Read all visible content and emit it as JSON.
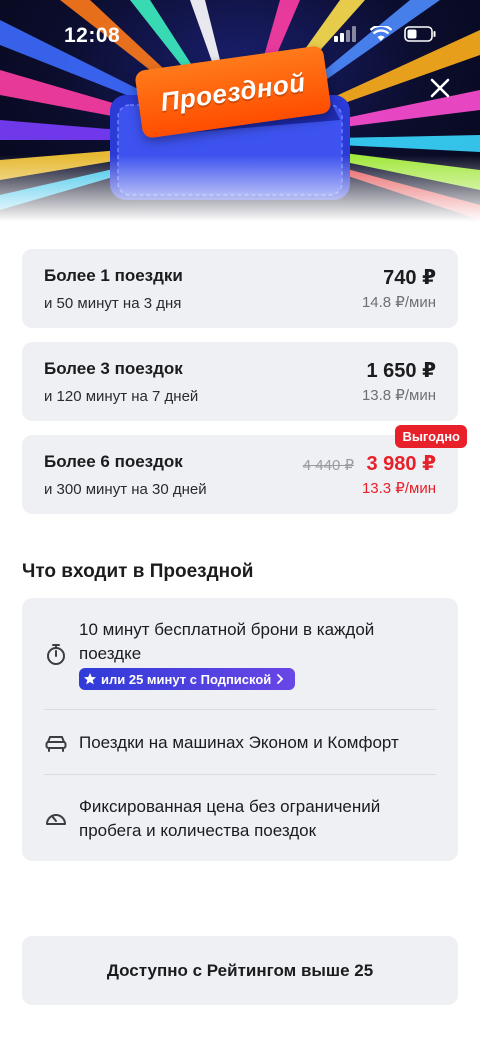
{
  "status_bar": {
    "time": "12:08"
  },
  "hero": {
    "ticket_label": "Проездной"
  },
  "plans": [
    {
      "title": "Более 1 поездки",
      "subtitle": "и 50 минут на 3 дня",
      "price": "740 ₽",
      "per_minute": "14.8 ₽/мин"
    },
    {
      "title": "Более 3 поездок",
      "subtitle": "и 120 минут на 7 дней",
      "price": "1 650 ₽",
      "per_minute": "13.8 ₽/мин"
    },
    {
      "title": "Более 6 поездок",
      "subtitle": "и 300 минут на 30 дней",
      "old_price": "4 440 ₽",
      "price": "3 980 ₽",
      "per_minute": "13.3 ₽/мин",
      "badge": "Выгодно"
    }
  ],
  "included": {
    "title": "Что входит в Проездной",
    "items": [
      {
        "icon": "stopwatch-icon",
        "text": "10 минут бесплатной брони в каждой поездке",
        "promo": "или 25 минут с Подпиской"
      },
      {
        "icon": "car-icon",
        "text": "Поездки на машинах Эконом и Комфорт"
      },
      {
        "icon": "speedometer-icon",
        "text": "Фиксированная цена без ограничений пробега и количества поездок"
      }
    ]
  },
  "cta": {
    "label": "Доступно с Рейтингом выше 25"
  },
  "colors": {
    "accent_red": "#e8202a",
    "card_bg": "#eef0f4",
    "promo_blue": "#2f3bd8",
    "ticket_orange": "#ff5a0a"
  }
}
